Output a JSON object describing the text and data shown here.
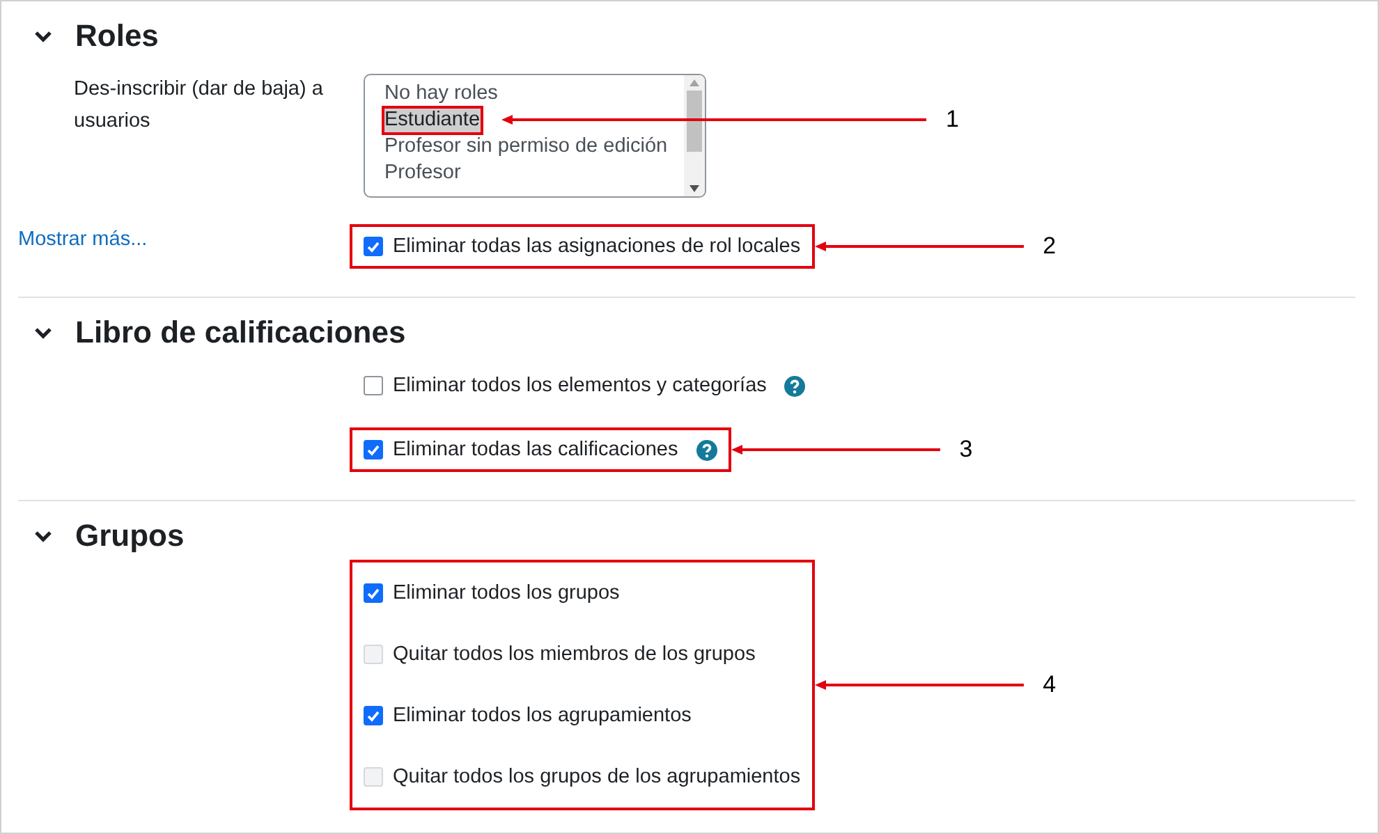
{
  "sections": [
    {
      "title": "Roles",
      "expanded": true,
      "listbox": {
        "label": "Des-inscribir (dar de baja) a usuarios",
        "options": [
          {
            "label": "No hay roles",
            "selected": false
          },
          {
            "label": "Estudiante",
            "selected": true,
            "callout": "1"
          },
          {
            "label": "Profesor sin permiso de edición",
            "selected": false
          },
          {
            "label": "Profesor",
            "selected": false
          }
        ]
      },
      "more_link": "Mostrar más...",
      "checkboxes": [
        {
          "label": "Eliminar todas las asignaciones de rol locales",
          "checked": true,
          "disabled": false,
          "help": false,
          "callout": "2"
        }
      ]
    },
    {
      "title": "Libro de calificaciones",
      "expanded": true,
      "checkboxes": [
        {
          "label": "Eliminar todos los elementos y categorías",
          "checked": false,
          "disabled": false,
          "help": true
        },
        {
          "label": "Eliminar todas las calificaciones",
          "checked": true,
          "disabled": false,
          "help": true,
          "callout": "3"
        }
      ]
    },
    {
      "title": "Grupos",
      "expanded": true,
      "group_callout": "4",
      "checkboxes": [
        {
          "label": "Eliminar todos los grupos",
          "checked": true,
          "disabled": false,
          "help": false
        },
        {
          "label": "Quitar todos los miembros de los grupos",
          "checked": false,
          "disabled": true,
          "help": false
        },
        {
          "label": "Eliminar todos los agrupamientos",
          "checked": true,
          "disabled": false,
          "help": false
        },
        {
          "label": "Quitar todos los grupos de los agrupamientos",
          "checked": false,
          "disabled": true,
          "help": false
        }
      ]
    }
  ]
}
